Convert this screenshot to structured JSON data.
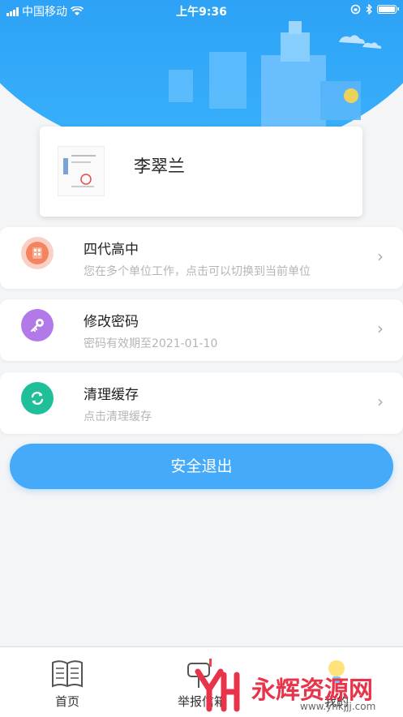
{
  "status_bar": {
    "carrier": "中国移动",
    "time": "上午9:36"
  },
  "profile": {
    "name": "李翠兰"
  },
  "menu": [
    {
      "title": "四代高中",
      "subtitle": "您在多个单位工作，点击可以切换到当前单位",
      "icon": "building-icon",
      "color": "#f4845f"
    },
    {
      "title": "修改密码",
      "subtitle": "密码有效期至2021-01-10",
      "icon": "key-icon",
      "color": "#b17ae8"
    },
    {
      "title": "清理缓存",
      "subtitle": "点击清理缓存",
      "icon": "refresh-icon",
      "color": "#1fbf9a"
    }
  ],
  "logout_label": "安全退出",
  "tabs": [
    {
      "label": "首页",
      "icon": "book-icon"
    },
    {
      "label": "举报信箱",
      "icon": "mailbox-icon"
    },
    {
      "label": "我的",
      "icon": "bulb-icon"
    }
  ],
  "watermark": {
    "text": "永辉资源网",
    "url": "www.yhkjjj.com"
  }
}
